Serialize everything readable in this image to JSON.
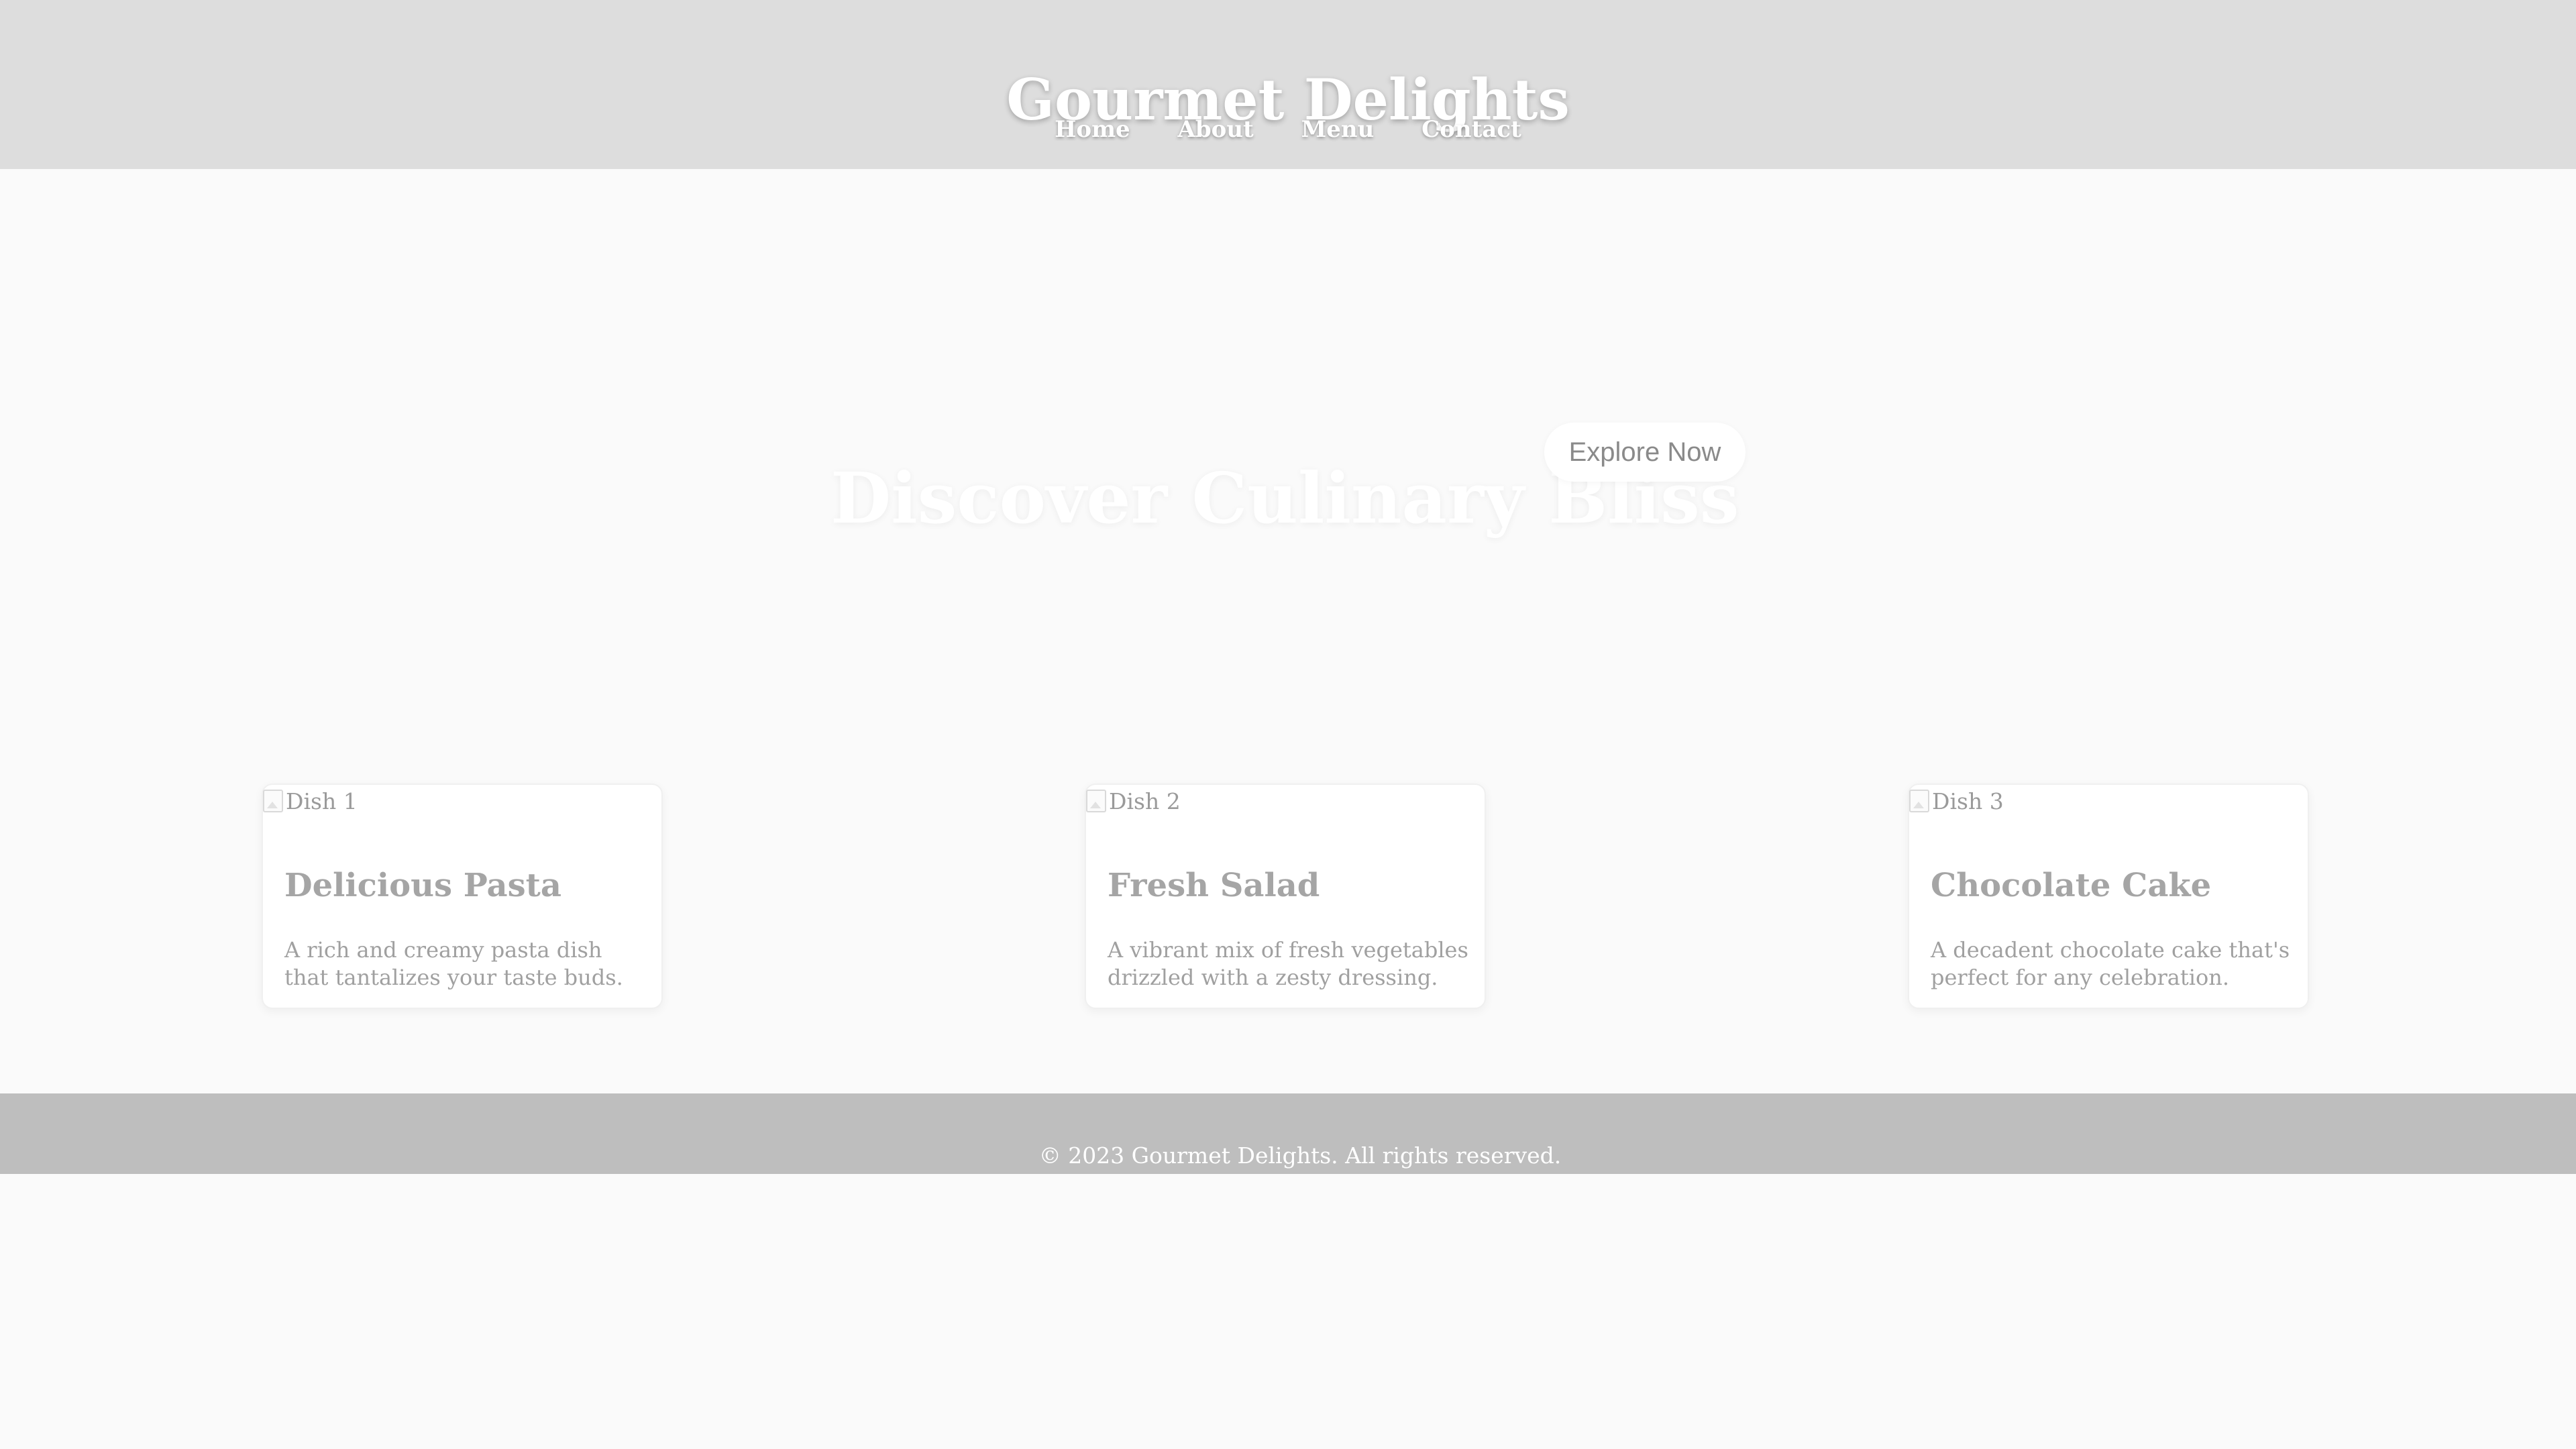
{
  "header": {
    "title": "Gourmet Delights",
    "nav": [
      "Home",
      "About",
      "Menu",
      "Contact"
    ]
  },
  "hero": {
    "title": "Discover Culinary Bliss",
    "button_label": "Explore Now"
  },
  "cards": [
    {
      "image_alt": "Dish 1",
      "title": "Delicious Pasta",
      "description": "A rich and creamy pasta dish that tantalizes your taste buds."
    },
    {
      "image_alt": "Dish 2",
      "title": "Fresh Salad",
      "description": "A vibrant mix of fresh vegetables drizzled with a zesty dressing."
    },
    {
      "image_alt": "Dish 3",
      "title": "Chocolate Cake",
      "description": "A decadent chocolate cake that's perfect for any celebration."
    }
  ],
  "footer": {
    "text": "© 2023 Gourmet Delights. All rights reserved."
  },
  "colors": {
    "header_bg": "#dddddd",
    "page_bg": "#fafafa",
    "footer_bg": "#bebebe",
    "card_bg": "#ffffff",
    "header_text": "#ffffff"
  },
  "icons": {
    "card_image": "broken-image-icon"
  }
}
